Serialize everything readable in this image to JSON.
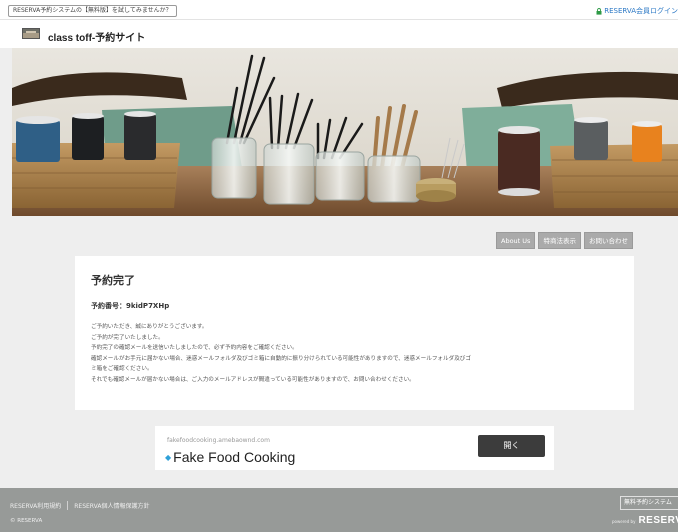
{
  "topbar": {
    "promo_label": "RESERVA予約システムの【無料版】を試してみませんか？",
    "login_label": "RESERVA会員ログイン"
  },
  "header": {
    "site_title": "class toff-予約サイト"
  },
  "nav": {
    "items": [
      "About Us",
      "特商法表示",
      "お問い合わせ"
    ]
  },
  "content": {
    "title": "予約完了",
    "booking_number": "予約番号：9kidP7XHp",
    "messages": [
      "ご予約いただき、誠にありがとうございます。",
      "ご予約が完了いたしました。",
      "予約完了の確認メールを送信いたしましたので、必ず予約内容をご確認ください。",
      "確認メールがお手元に届かない場合、迷惑メールフォルダ及びゴミ箱に自動的に振り分けられている可能性がありますので、迷惑メールフォルダ及びゴ",
      "ミ箱をご確認ください。",
      "それでも確認メールが届かない場合は、ご入力のメールアドレスが間違っている可能性がありますので、お問い合わせください。"
    ]
  },
  "ad": {
    "url": "fakefoodcooking.amebaownd.com",
    "title": "Fake Food Cooking",
    "button_label": "開く"
  },
  "footer": {
    "links": [
      "RESERVA利用規約",
      "RESERVA個人情報保護方針"
    ],
    "copyright": "© RESERVA",
    "badge_label": "無料予約システム",
    "powered_by": "powered by",
    "brand": "RESERVA"
  },
  "colors": {
    "login_link": "#2b78c5",
    "nav_button": "#aaaaaa",
    "footer_bg": "#979a98",
    "ad_button": "#3c3c3c"
  }
}
